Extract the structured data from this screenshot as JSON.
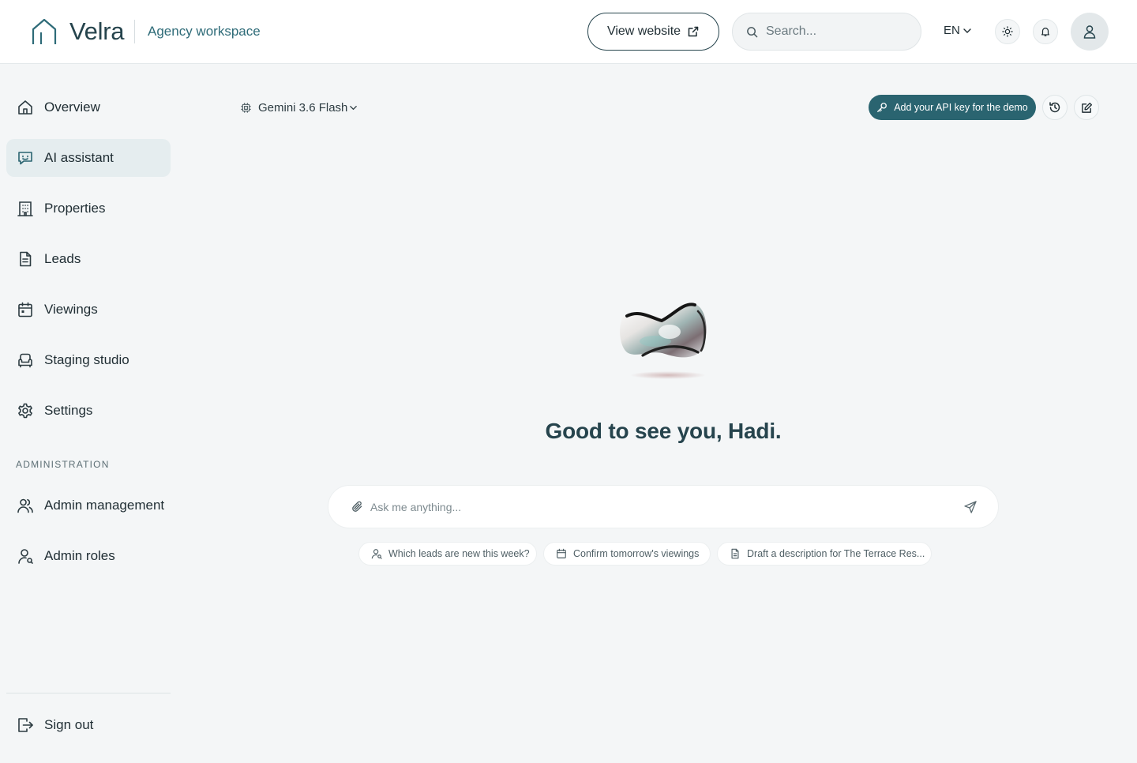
{
  "header": {
    "brand_name": "Velra",
    "brand_subtitle": "Agency workspace",
    "view_website_label": "View website",
    "search_placeholder": "Search...",
    "language": "EN"
  },
  "sidebar": {
    "items": [
      {
        "label": "Overview",
        "icon": "home-icon",
        "active": false
      },
      {
        "label": "AI assistant",
        "icon": "chat-bot-icon",
        "active": true
      },
      {
        "label": "Properties",
        "icon": "building-icon",
        "active": false
      },
      {
        "label": "Leads",
        "icon": "document-icon",
        "active": false
      },
      {
        "label": "Viewings",
        "icon": "calendar-icon",
        "active": false
      },
      {
        "label": "Staging studio",
        "icon": "armchair-icon",
        "active": false
      },
      {
        "label": "Settings",
        "icon": "gear-icon",
        "active": false
      }
    ],
    "admin_section_label": "ADMINISTRATION",
    "admin_items": [
      {
        "label": "Admin management",
        "icon": "users-icon"
      },
      {
        "label": "Admin roles",
        "icon": "user-role-icon"
      }
    ],
    "sign_out_label": "Sign out"
  },
  "assistant": {
    "model_name": "Gemini 3.6 Flash",
    "api_key_button": "Add your API key for the demo",
    "greeting": "Good to see you, Hadi.",
    "input_placeholder": "Ask me anything...",
    "suggestions": [
      {
        "label": "Which leads are new this week?",
        "icon": "user-search-icon"
      },
      {
        "label": "Confirm tomorrow's viewings",
        "icon": "calendar-icon"
      },
      {
        "label": "Draft a description for The Terrace Res...",
        "icon": "document-icon"
      }
    ]
  },
  "colors": {
    "accent": "#2a6470",
    "brand_text": "#26444d",
    "background": "#f4f6f7",
    "active_nav": "#e5edef"
  }
}
